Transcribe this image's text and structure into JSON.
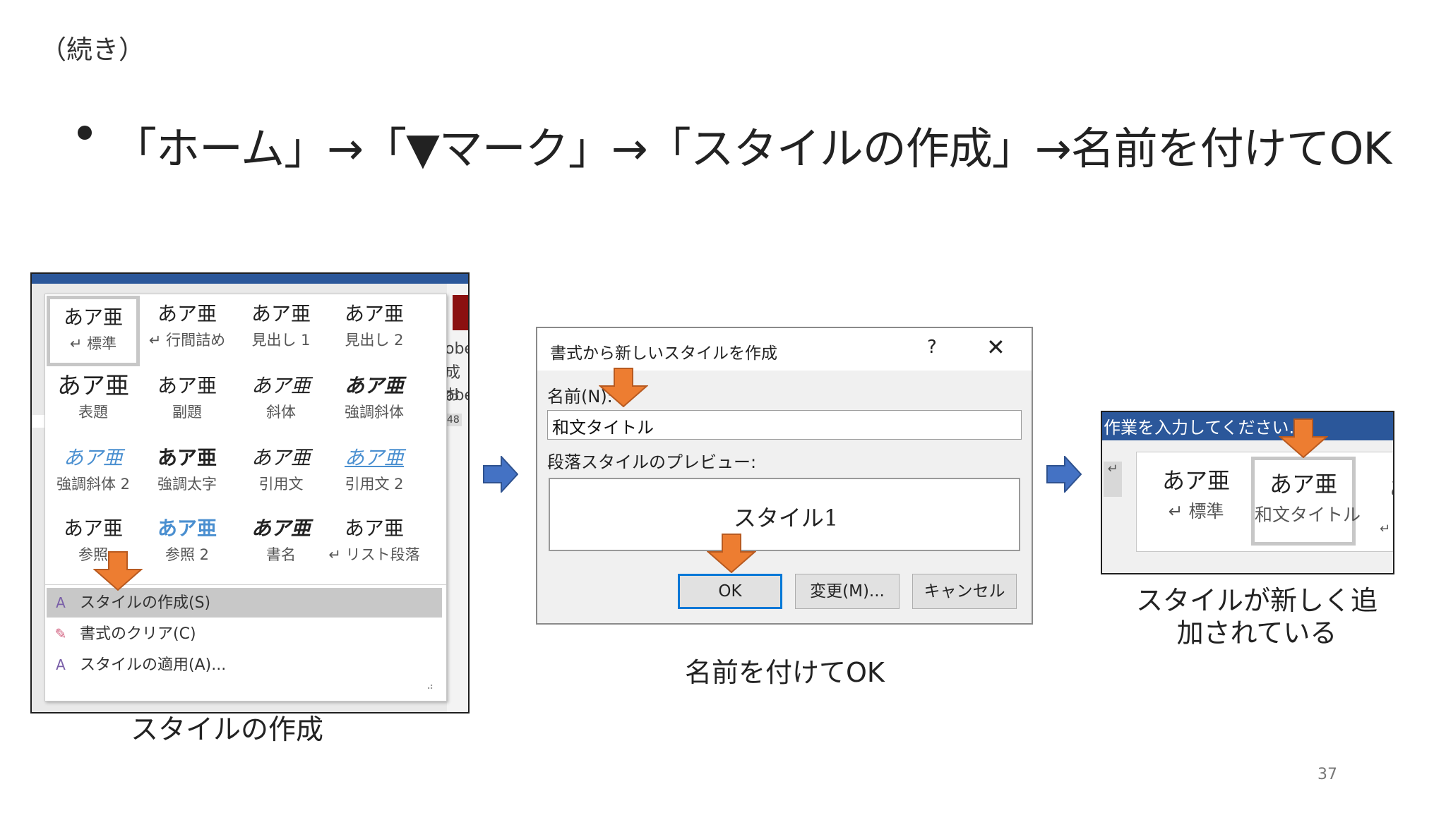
{
  "slide": {
    "continued": "（続き）",
    "headline": "「ホーム」→「▼マーク」→「スタイルの作成」→名前を付けてOK",
    "page_number": "37"
  },
  "panel1": {
    "caption": "スタイルの作成",
    "cut_text_1": "obe",
    "cut_text_2": "成お",
    "cut_text_3": "obe",
    "badge": "48",
    "styles": [
      {
        "glyph": "あア亜",
        "label": "↵ 標準"
      },
      {
        "glyph": "あア亜",
        "label": "↵ 行間詰め"
      },
      {
        "glyph": "あア亜",
        "label": "見出し 1"
      },
      {
        "glyph": "あア亜",
        "label": "見出し 2"
      },
      {
        "glyph": "あア亜",
        "label": "表題"
      },
      {
        "glyph": "あア亜",
        "label": "副題"
      },
      {
        "glyph": "あア亜",
        "label": "斜体"
      },
      {
        "glyph": "あア亜",
        "label": "強調斜体"
      },
      {
        "glyph": "あア亜",
        "label": "強調斜体 2"
      },
      {
        "glyph": "あア亜",
        "label": "強調太字"
      },
      {
        "glyph": "あア亜",
        "label": "引用文"
      },
      {
        "glyph": "あア亜",
        "label": "引用文 2"
      },
      {
        "glyph": "あア亜",
        "label": "参照"
      },
      {
        "glyph": "あア亜",
        "label": "参照 2"
      },
      {
        "glyph": "あア亜",
        "label": "書名"
      },
      {
        "glyph": "あア亜",
        "label": "↵ リスト段落"
      }
    ],
    "menu": [
      {
        "icon": "A",
        "label": "スタイルの作成(S)"
      },
      {
        "icon": "✎",
        "label": "書式のクリア(C)"
      },
      {
        "icon": "A",
        "label": "スタイルの適用(A)..."
      }
    ],
    "grip": "⠴"
  },
  "panel2": {
    "title": "書式から新しいスタイルを作成",
    "help": "?",
    "close": "✕",
    "name_label": "名前(N):",
    "name_value": "和文タイトル",
    "preview_label": "段落スタイルのプレビュー:",
    "preview_text": "スタイル1",
    "ok": "OK",
    "modify": "変更(M)...",
    "cancel": "キャンセル",
    "caption": "名前を付けてOK"
  },
  "panel3": {
    "bar_text": "作業を入力してください...",
    "return_mark": "↵",
    "styles": [
      {
        "glyph": "あア亜",
        "label": "↵ 標準"
      },
      {
        "glyph": "あア亜",
        "label": "和文タイトル"
      }
    ],
    "cut_glyph": "あ",
    "cut_mark": "↵",
    "caption_line1": "スタイルが新しく追",
    "caption_line2": "加されている"
  },
  "colors": {
    "ribbon_blue": "#2b579a",
    "arrow_blue": "#4472c4",
    "arrow_orange": "#ed7d31",
    "ok_border": "#0078d7"
  }
}
